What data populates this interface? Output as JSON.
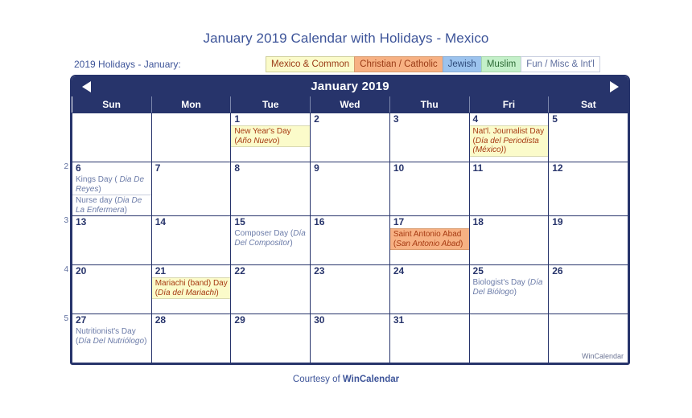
{
  "page": {
    "title": "January 2019 Calendar with Holidays - Mexico",
    "footer_prefix": "Courtesy of ",
    "footer_brand": "WinCalendar",
    "watermark": "WinCalendar"
  },
  "legend": {
    "label": "2019 Holidays - January:",
    "items": [
      {
        "label": "Mexico & Common",
        "color": "#fbfbca"
      },
      {
        "label": "Christian / Catholic",
        "color": "#f7b183"
      },
      {
        "label": "Jewish",
        "color": "#9cc3ee"
      },
      {
        "label": "Muslim",
        "color": "#c4f0c9"
      },
      {
        "label": "Fun / Misc & Int'l",
        "color": "#ffffff"
      }
    ]
  },
  "calendar": {
    "month_title": "January 2019",
    "prev_label": "previous month",
    "next_label": "next month",
    "weekdays": [
      "Sun",
      "Mon",
      "Tue",
      "Wed",
      "Thu",
      "Fri",
      "Sat"
    ],
    "week_numbers": [
      "",
      "2",
      "3",
      "4",
      "5"
    ],
    "weeks": [
      [
        {
          "day": "",
          "filler": true
        },
        {
          "day": "",
          "filler": true
        },
        {
          "day": "1",
          "events": [
            {
              "text": "New Year's Day (",
              "em": "Año Nuevo",
              "tail": ")",
              "type": "mexico"
            }
          ]
        },
        {
          "day": "2"
        },
        {
          "day": "3"
        },
        {
          "day": "4",
          "events": [
            {
              "text": "Nat'l. Journalist Day (",
              "em": "Día del Periodista (México)",
              "tail": ")",
              "type": "mexico"
            }
          ]
        },
        {
          "day": "5",
          "weekend": true
        }
      ],
      [
        {
          "day": "6",
          "weekend": true,
          "events": [
            {
              "text": "Kings Day ( ",
              "em": "Dia De Reyes",
              "tail": ")",
              "type": "fun"
            },
            {
              "text": "Nurse day (",
              "em": "Dia De La Enfermera",
              "tail": ")",
              "type": "fun"
            }
          ]
        },
        {
          "day": "7"
        },
        {
          "day": "8"
        },
        {
          "day": "9"
        },
        {
          "day": "10"
        },
        {
          "day": "11"
        },
        {
          "day": "12",
          "weekend": true
        }
      ],
      [
        {
          "day": "13",
          "weekend": true
        },
        {
          "day": "14"
        },
        {
          "day": "15",
          "events": [
            {
              "text": "Composer Day (",
              "em": "Día Del Compositor",
              "tail": ")",
              "type": "fun"
            }
          ]
        },
        {
          "day": "16"
        },
        {
          "day": "17",
          "events": [
            {
              "text": "Saint Antonio Abad (",
              "em": "San Antonio Abad",
              "tail": ")",
              "type": "christian"
            }
          ]
        },
        {
          "day": "18"
        },
        {
          "day": "19",
          "weekend": true
        }
      ],
      [
        {
          "day": "20",
          "weekend": true
        },
        {
          "day": "21",
          "events": [
            {
              "text": "Mariachi (band) Day (",
              "em": "Día del Mariachi",
              "tail": ")",
              "type": "mexico"
            }
          ]
        },
        {
          "day": "22"
        },
        {
          "day": "23"
        },
        {
          "day": "24"
        },
        {
          "day": "25",
          "events": [
            {
              "text": "Biologist's Day (",
              "em": "Día Del Biólogo",
              "tail": ")",
              "type": "fun"
            }
          ]
        },
        {
          "day": "26",
          "weekend": true
        }
      ],
      [
        {
          "day": "27",
          "weekend": true,
          "events": [
            {
              "text": "Nutritionist's Day (",
              "em": "Día Del Nutriólogo",
              "tail": ")",
              "type": "fun"
            }
          ]
        },
        {
          "day": "28"
        },
        {
          "day": "29"
        },
        {
          "day": "30"
        },
        {
          "day": "31"
        },
        {
          "day": "",
          "filler": true
        },
        {
          "day": "",
          "filler": true,
          "watermark": true
        }
      ]
    ]
  }
}
